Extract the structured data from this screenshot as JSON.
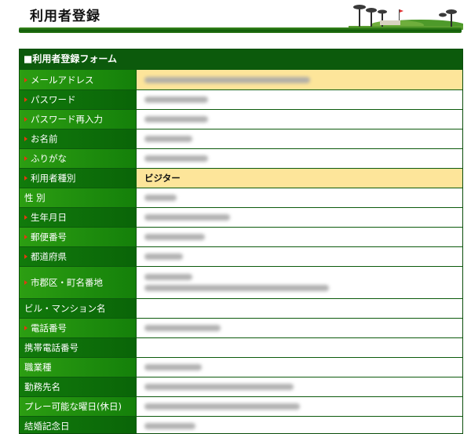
{
  "page": {
    "title": "利用者登録"
  },
  "form": {
    "header": "■利用者登録フォーム",
    "fields": [
      {
        "label": "メールアドレス",
        "required": true,
        "highlight": true,
        "value": "",
        "redacted": [
          0.52
        ]
      },
      {
        "label": "パスワード",
        "required": true,
        "highlight": false,
        "value": "",
        "redacted": [
          0.2
        ]
      },
      {
        "label": "パスワード再入力",
        "required": true,
        "highlight": false,
        "value": "",
        "redacted": [
          0.2
        ]
      },
      {
        "label": "お名前",
        "required": true,
        "highlight": false,
        "value": "",
        "redacted": [
          0.15
        ]
      },
      {
        "label": "ふりがな",
        "required": true,
        "highlight": false,
        "value": "",
        "redacted": [
          0.2
        ]
      },
      {
        "label": "利用者種別",
        "required": true,
        "highlight": true,
        "value": "ビジター",
        "redacted": []
      },
      {
        "label": "性 別",
        "required": false,
        "highlight": false,
        "value": "",
        "redacted": [
          0.1
        ]
      },
      {
        "label": "生年月日",
        "required": true,
        "highlight": false,
        "value": "",
        "redacted": [
          0.27
        ]
      },
      {
        "label": "郵便番号",
        "required": true,
        "highlight": false,
        "value": "",
        "redacted": [
          0.19
        ]
      },
      {
        "label": "都道府県",
        "required": true,
        "highlight": false,
        "value": "",
        "redacted": [
          0.12
        ]
      },
      {
        "label": "市郡区・町名番地",
        "required": true,
        "highlight": false,
        "value": "",
        "redacted": [
          0.15,
          0.58
        ]
      },
      {
        "label": "ビル・マンション名",
        "required": false,
        "highlight": false,
        "value": "",
        "redacted": []
      },
      {
        "label": "電話番号",
        "required": true,
        "highlight": false,
        "value": "",
        "redacted": [
          0.24
        ]
      },
      {
        "label": "携帯電話番号",
        "required": false,
        "highlight": false,
        "value": "",
        "redacted": []
      },
      {
        "label": "職業種",
        "required": false,
        "highlight": false,
        "value": "",
        "redacted": [
          0.18
        ]
      },
      {
        "label": "勤務先名",
        "required": false,
        "highlight": false,
        "value": "",
        "redacted": [
          0.47
        ]
      },
      {
        "label": "プレー可能な曜日(休日)",
        "required": false,
        "highlight": false,
        "value": "",
        "redacted": [
          0.49
        ]
      },
      {
        "label": "結婚記念日",
        "required": false,
        "highlight": false,
        "value": "",
        "redacted": [
          0.16
        ]
      }
    ]
  },
  "colors": {
    "label_green": "#14800a",
    "frame_green": "#0c5a0c",
    "highlight_yellow": "#fde59a",
    "required_mark": "#e03a10"
  }
}
